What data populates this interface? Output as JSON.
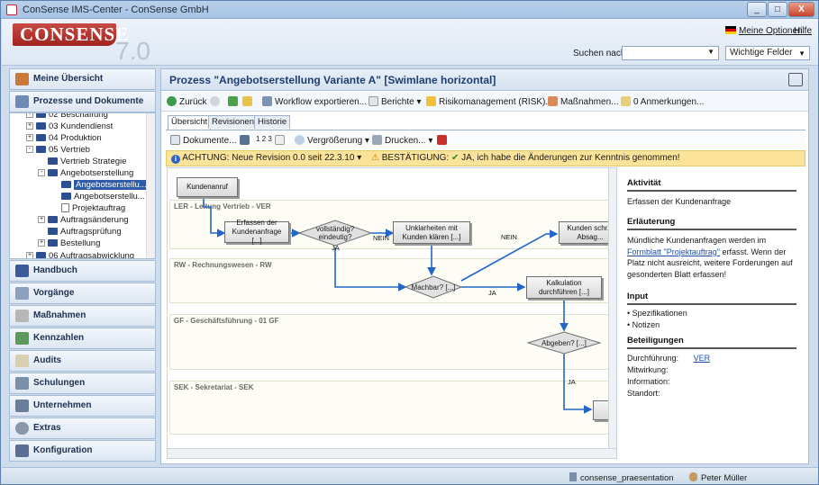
{
  "window": {
    "title": "ConSense IMS-Center - ConSense GmbH",
    "controls": [
      "_",
      "□",
      "X"
    ]
  },
  "header": {
    "logo_text": "CONSENSE",
    "logo_version": "7.0",
    "options_link": "Meine Optionen",
    "help_link": "Hilfe",
    "search_label": "Suchen nach",
    "search_value": "",
    "search_scope": "Wichtige Felder"
  },
  "sidebar": {
    "top": [
      {
        "label": "Meine Übersicht",
        "icon": "house-icon"
      },
      {
        "label": "Prozesse und Dokumente",
        "icon": "process-icon"
      }
    ],
    "tree": [
      {
        "label": "02 Beschaffung",
        "level": 0,
        "toggle": "+"
      },
      {
        "label": "03 Kundendienst",
        "level": 0,
        "toggle": "+"
      },
      {
        "label": "04 Produktion",
        "level": 0,
        "toggle": "+"
      },
      {
        "label": "05 Vertrieb",
        "level": 0,
        "toggle": "-"
      },
      {
        "label": "Vertrieb Strategie",
        "level": 1,
        "toggle": ""
      },
      {
        "label": "Angebotserstellung",
        "level": 1,
        "toggle": "-"
      },
      {
        "label": "Angebotserstellu...",
        "level": 2,
        "toggle": "",
        "selected": true
      },
      {
        "label": "Angebotserstellu...",
        "level": 2,
        "toggle": ""
      },
      {
        "label": "Projektauftrag",
        "level": 2,
        "toggle": ""
      },
      {
        "label": "Auftragsänderung",
        "level": 1,
        "toggle": "+"
      },
      {
        "label": "Auftragsprüfung",
        "level": 1,
        "toggle": ""
      },
      {
        "label": "Bestellung",
        "level": 1,
        "toggle": "+"
      },
      {
        "label": "06 Auftragsabwicklung",
        "level": 0,
        "toggle": "+"
      }
    ],
    "bottom": [
      {
        "label": "Handbuch",
        "icon": "book-icon"
      },
      {
        "label": "Vorgänge",
        "icon": "list-icon"
      },
      {
        "label": "Maßnahmen",
        "icon": "clipboard-icon"
      },
      {
        "label": "Kennzahlen",
        "icon": "chart-icon"
      },
      {
        "label": "Audits",
        "icon": "audit-icon"
      },
      {
        "label": "Schulungen",
        "icon": "training-icon"
      },
      {
        "label": "Unternehmen",
        "icon": "company-icon"
      },
      {
        "label": "Extras",
        "icon": "gears-icon"
      },
      {
        "label": "Konfiguration",
        "icon": "config-icon"
      }
    ]
  },
  "main": {
    "title": "Prozess \"Angebotserstellung Variante A\" [Swimlane horizontal]",
    "toolbar": {
      "back": "Zurück",
      "workflow": "Workflow exportieren...",
      "reports": "Berichte",
      "risk": "Risikomanagement (RISK)...",
      "measures": "Maßnahmen...",
      "notes": "0 Anmerkungen..."
    },
    "tabs": [
      "Übersicht",
      "Revisionen",
      "Historie"
    ],
    "subtoolbar": {
      "documents": "Dokumente...",
      "zoom": "Vergrößerung",
      "print": "Drucken...",
      "numbering": "1 2 3"
    },
    "warning": {
      "attention": "ACHTUNG:  Neue Revision 0.0 seit 22.3.10",
      "confirmation_label": "BESTÄTIGUNG:",
      "confirmation_text": "JA, ich habe die Änderungen zur Kenntnis genommen!"
    }
  },
  "diagram": {
    "lanes": [
      "LER - Leitung Vertrieb - VER",
      "RW - Rechnungswesen - RW",
      "GF - Geschäftsführung - 01 GF",
      "SEK - Sekretariat - SEK"
    ],
    "nodes": {
      "start": "Kundenanruf",
      "capture": "Erfassen der Kundenanfrage [...]",
      "complete": "vollständig? eindeutig?",
      "clarify": "Unklarheiten mit Kunden klären [...]",
      "customer_right": "Kunden schr... Absag...",
      "feasible": "Machbar? [...]",
      "calc": "Kalkulation durchführen [...]",
      "submit": "Abgeben? [...]"
    },
    "edges": {
      "nein1": "NEIN",
      "ja1": "JA",
      "nein2": "NEIN",
      "ja2": "JA",
      "ja3": "JA"
    }
  },
  "details": {
    "activity_heading": "Aktivität",
    "activity": "Erfassen der Kundenanfrage",
    "explanation_heading": "Erläuterung",
    "explanation_pre": "Mündliche Kundenanfragen werden im",
    "explanation_link": "Formblatt \"Projektauftrag\"",
    "explanation_post": "erfasst. Wenn der Platz nicht ausreicht, weitere Forderungen auf gesonderten Blatt erfassen!",
    "input_heading": "Input",
    "inputs": [
      "Spezifikationen",
      "Notizen"
    ],
    "participants_heading": "Beteiligungen",
    "participants": [
      {
        "label": "Durchführung:",
        "value": "VER"
      },
      {
        "label": "Mitwirkung:",
        "value": ""
      },
      {
        "label": "Information:",
        "value": ""
      },
      {
        "label": "Standort:",
        "value": ""
      }
    ]
  },
  "status": {
    "database": "consense_praesentation",
    "user": "Peter Müller"
  }
}
